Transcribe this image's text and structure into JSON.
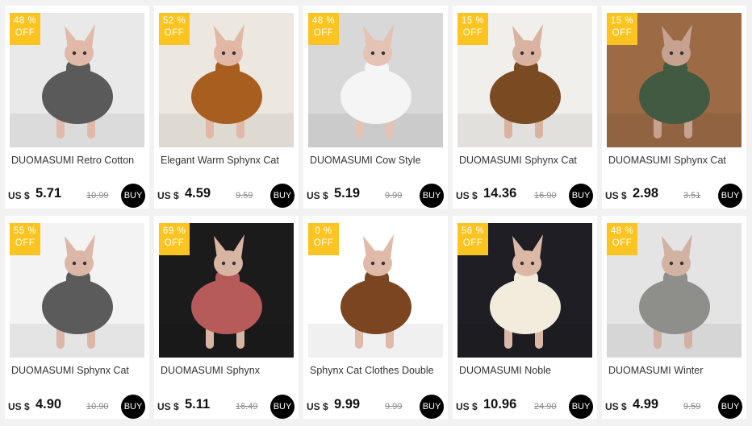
{
  "products": [
    {
      "discount": "48 %",
      "off": "OFF",
      "title": "DUOMASUMI Retro Cotton",
      "currency": "US $",
      "price": "5.71",
      "old_price": "10.99",
      "buy": "BUY",
      "bg": "#e9e9e9",
      "garment": "#5a5a5a",
      "cat": "#e0b9a9",
      "icon": "cat-leopard-hoodie-image"
    },
    {
      "discount": "52 %",
      "off": "OFF",
      "title": "Elegant  Warm  Sphynx Cat",
      "currency": "US $",
      "price": "4.59",
      "old_price": "9.59",
      "buy": "BUY",
      "bg": "#ece7df",
      "garment": "#a85e1f",
      "cat": "#e2b7a6",
      "icon": "cat-orange-fleece-image"
    },
    {
      "discount": "48 %",
      "off": "OFF",
      "title": "DUOMASUMI Cow Style",
      "currency": "US $",
      "price": "5.19",
      "old_price": "9.99",
      "buy": "BUY",
      "bg": "#d8d8d8",
      "garment": "#f5f5f5",
      "cat": "#e4c2b4",
      "icon": "cat-cow-pattern-image"
    },
    {
      "discount": "15 %",
      "off": "OFF",
      "title": "DUOMASUMI Sphynx Cat",
      "currency": "US $",
      "price": "14.36",
      "old_price": "16.90",
      "buy": "BUY",
      "bg": "#f0efeb",
      "garment": "#7a4a22",
      "cat": "#d9b3a0",
      "icon": "cat-leopard-coat-image"
    },
    {
      "discount": "15 %",
      "off": "OFF",
      "title": "DUOMASUMI Sphynx Cat",
      "currency": "US $",
      "price": "2.98",
      "old_price": "3.51",
      "buy": "BUY",
      "bg": "#9c6a45",
      "garment": "#425a42",
      "cat": "#c7a38f",
      "icon": "cat-green-sweater-image"
    },
    {
      "discount": "55 %",
      "off": "OFF",
      "title": "DUOMASUMI Sphynx Cat",
      "currency": "US $",
      "price": "4.90",
      "old_price": "10.90",
      "buy": "BUY",
      "bg": "#f3f3f3",
      "garment": "#5b5b5b",
      "cat": "#dcb6a7",
      "icon": "cat-grey-hoodie-image"
    },
    {
      "discount": "69 %",
      "off": "OFF",
      "title": "DUOMASUMI Sphynx",
      "currency": "US $",
      "price": "5.11",
      "old_price": "16.49",
      "buy": "BUY",
      "bg": "#1b1b1b",
      "garment": "#b65a5a",
      "cat": "#d8b4a3",
      "icon": "cat-plaid-shirt-image"
    },
    {
      "discount": "0 %",
      "off": "OFF",
      "title": "Sphynx Cat Clothes Double",
      "currency": "US $",
      "price": "9.99",
      "old_price": "9.99",
      "buy": "BUY",
      "bg": "#ffffff",
      "garment": "#7a4520",
      "cat": "#e0baa8",
      "icon": "cat-leopard-fur-coat-image"
    },
    {
      "discount": "56 %",
      "off": "OFF",
      "title": "DUOMASUMI Noble",
      "currency": "US $",
      "price": "10.96",
      "old_price": "24.90",
      "buy": "BUY",
      "bg": "#1e1e24",
      "garment": "#f2ecdc",
      "cat": "#dcb8a6",
      "icon": "cat-white-sweater-image"
    },
    {
      "discount": "48 %",
      "off": "OFF",
      "title": "DUOMASUMI Winter",
      "currency": "US $",
      "price": "4.99",
      "old_price": "9.59",
      "buy": "BUY",
      "bg": "#e4e4e4",
      "garment": "#8e8e8a",
      "cat": "#d2b2a2",
      "icon": "cat-grey-fleece-image"
    }
  ],
  "colors": {
    "badge": "#fcc421",
    "buy": "#000000",
    "card": "#ffffff",
    "page": "#f2f2f2"
  }
}
